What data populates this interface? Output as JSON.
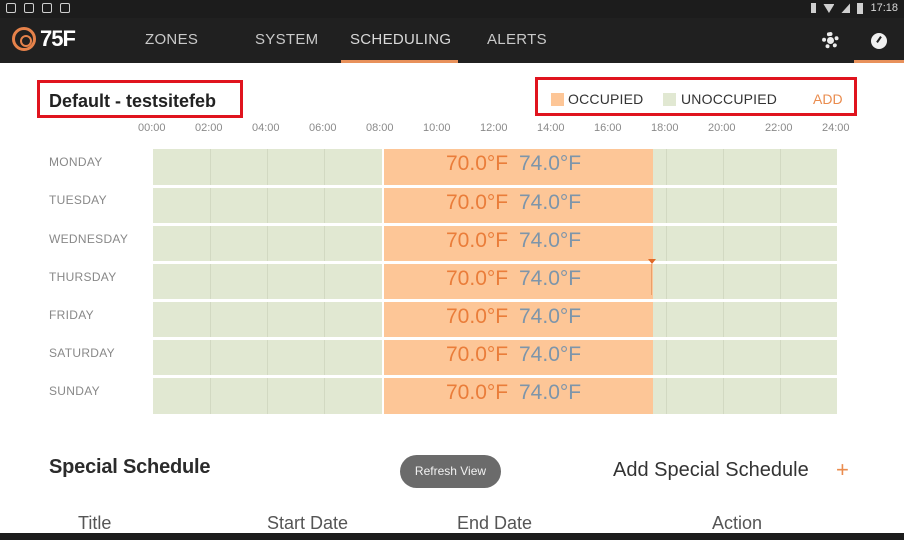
{
  "status_bar": {
    "time": "17:18"
  },
  "nav": {
    "logo_text": "75F",
    "tabs": [
      {
        "label": "ZONES",
        "active": false
      },
      {
        "label": "SYSTEM",
        "active": false
      },
      {
        "label": "SCHEDULING",
        "active": true
      },
      {
        "label": "ALERTS",
        "active": false
      }
    ],
    "icons": [
      "gear-icon",
      "dashboard-icon"
    ]
  },
  "schedule": {
    "name": "Default - testsitefeb",
    "legend": {
      "occupied_label": "OCCUPIED",
      "unoccupied_label": "UNOCCUPIED",
      "add_label": "ADD",
      "occupied_color": "#fdc697",
      "unoccupied_color": "#e1e8d2"
    },
    "time_labels": [
      "00:00",
      "02:00",
      "04:00",
      "06:00",
      "08:00",
      "10:00",
      "12:00",
      "14:00",
      "16:00",
      "18:00",
      "20:00",
      "22:00",
      "24:00"
    ],
    "days": [
      {
        "label": "MONDAY",
        "heating": "70.0°F",
        "cooling": "74.0°F"
      },
      {
        "label": "TUESDAY",
        "heating": "70.0°F",
        "cooling": "74.0°F"
      },
      {
        "label": "WEDNESDAY",
        "heating": "70.0°F",
        "cooling": "74.0°F"
      },
      {
        "label": "THURSDAY",
        "heating": "70.0°F",
        "cooling": "74.0°F"
      },
      {
        "label": "FRIDAY",
        "heating": "70.0°F",
        "cooling": "74.0°F"
      },
      {
        "label": "SATURDAY",
        "heating": "70.0°F",
        "cooling": "74.0°F"
      },
      {
        "label": "SUNDAY",
        "heating": "70.0°F",
        "cooling": "74.0°F"
      }
    ],
    "heating_color": "#ea7d3a",
    "cooling_color": "#7d95aa"
  },
  "special": {
    "title": "Special Schedule",
    "refresh_label": "Refresh View",
    "add_label": "Add Special Schedule",
    "add_icon": "+",
    "columns": [
      "Title",
      "Start Date",
      "End Date",
      "Action"
    ]
  }
}
